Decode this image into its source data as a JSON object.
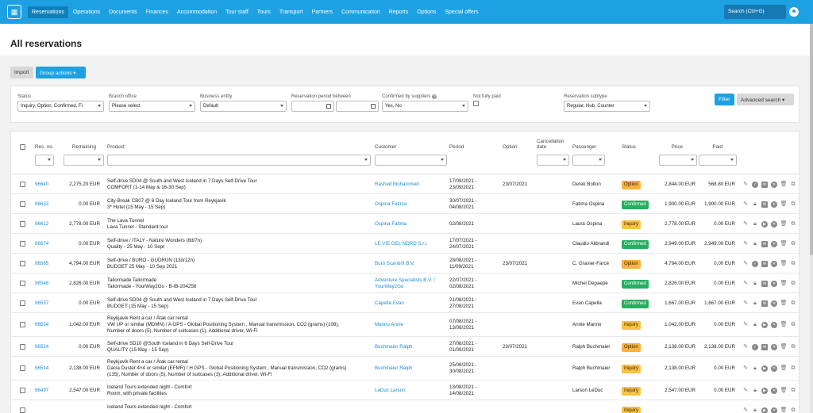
{
  "nav": {
    "items": [
      "Reservations",
      "Operations",
      "Documents",
      "Finances",
      "Accommodation",
      "Tour staff",
      "Tours",
      "Transport",
      "Partners",
      "Communication",
      "Reports",
      "Options",
      "Special offers"
    ],
    "search_label": "Search (Ctrl+G)"
  },
  "page": {
    "title": "All reservations"
  },
  "actions": {
    "import_label": "Import",
    "group_actions_label": "Group actions ▾"
  },
  "filters": {
    "status_label": "Status",
    "status_value": "Inquiry, Option, Confirmed, Fi",
    "branch_label": "Branch office",
    "branch_value": "Please select",
    "entity_label": "Business entity",
    "entity_value": "Default",
    "period_label": "Reservation period between",
    "confirmed_label": "Confirmed by suppliers",
    "confirmed_value": "Yes, No",
    "not_paid_label": "Not fully paid",
    "subtype_label": "Reservation subtype",
    "subtype_value": "Regular, Hub, Counter",
    "filter_label": "Filter",
    "advanced_label": "Advanced search ▾"
  },
  "table": {
    "headers": {
      "res_no": "Res. no.",
      "remaining": "Remaining",
      "product": "Product",
      "customer": "Customer",
      "period": "Period",
      "option": "Option",
      "cancellation_1": "Cancellation",
      "cancellation_2": "date",
      "passenger": "Passenger",
      "status": "Status",
      "price": "Price",
      "paid": "Paid"
    },
    "rows": [
      {
        "no": "96640",
        "remaining": "2,275.20 EUR",
        "product1": "Self-drive SD04 @ South and West Iceland in 7 Days Self-Drive Tour",
        "product2": "COMFORT (1-14 May & 16-30 Sep)",
        "product3": "",
        "customer1": "Rashed Mohammed",
        "customer2": "",
        "period1": "17/09/2021 -",
        "period2": "23/09/2021",
        "option": "23/07/2021",
        "passenger": "Derek Bolton",
        "status": "Option",
        "price": "2,844.00 EUR",
        "paid": "568.80 EUR"
      },
      {
        "no": "96633",
        "remaining": "0.00 EUR",
        "product1": "City-Break CB07 @ 6 Day Iceland Tour from Reykjavik",
        "product2": "3* Hotel (15 May - 15 Sep)",
        "product3": "",
        "customer1": "Ospina Fatima",
        "customer2": "",
        "period1": "30/07/2021 -",
        "period2": "04/08/2021",
        "option": "",
        "passenger": "Fatima Ospina",
        "status": "Confirmed",
        "price": "1,900.00 EUR",
        "paid": "1,900.00 EUR"
      },
      {
        "no": "96612",
        "remaining": "2,778.00 EUR",
        "product1": "The Lava Tunnel",
        "product2": "Lava Tunnel - Standard tour",
        "product3": "",
        "customer1": "Ospina Fatima",
        "customer2": "",
        "period1": "02/08/2021",
        "period2": "",
        "option": "",
        "passenger": "Laura Ospina",
        "status": "Inquiry",
        "price": "2,778.00 EUR",
        "paid": "0.00 EUR"
      },
      {
        "no": "96574",
        "remaining": "0.00 EUR",
        "product1": "Self-drive / ITALY - Nature Wonders (8d/7n)",
        "product2": "Quality - 25 May - 10 Sept",
        "product3": "",
        "customer1": "LE VIE DEL NORD S.r.l.",
        "customer2": "",
        "period1": "17/07/2021 -",
        "period2": "24/07/2021",
        "option": "",
        "passenger": "Claudio Alibrandi",
        "status": "Confirmed",
        "price": "2,949.00 EUR",
        "paid": "2,949.00 EUR"
      },
      {
        "no": "96565",
        "remaining": "4,794.00 EUR",
        "product1": "Self-drive / BURO - GUDRUN (13d/12n)",
        "product2": "BUDGET 25 May - 10 Sep 2021",
        "product3": "",
        "customer1": "Buro Scanbrit B.V.",
        "customer2": "",
        "period1": "28/08/2021 -",
        "period2": "11/09/2021",
        "option": "23/07/2021",
        "passenger": "C. Gravier-Farcé",
        "status": "Option",
        "price": "4,794.00 EUR",
        "paid": "0.00 EUR"
      },
      {
        "no": "96548",
        "remaining": "2,826.00 EUR",
        "product1": "Tailormade Tailormade",
        "product2": "Tailormade - YourWay2Go - B-IB-204258",
        "product3": "",
        "customer1": "Adventure Specialists B.V. /",
        "customer2": "YourWay2Go",
        "period1": "22/07/2021 -",
        "period2": "02/08/2021",
        "option": "",
        "passenger": "Michel Depaepe",
        "status": "Confirmed",
        "price": "2,826.00 EUR",
        "paid": "0.00 EUR"
      },
      {
        "no": "96537",
        "remaining": "0.00 EUR",
        "product1": "Self-drive SD04 @ South and West Iceland in 7 Days Self-Drive Tour",
        "product2": "BUDGET (15 May - 15 Sep)",
        "product3": "",
        "customer1": "Capella Evan",
        "customer2": "",
        "period1": "21/08/2021 -",
        "period2": "27/08/2021",
        "option": "",
        "passenger": "Evan Capella",
        "status": "Confirmed",
        "price": "1,667.00 EUR",
        "paid": "1,667.00 EUR"
      },
      {
        "no": "96534",
        "remaining": "1,042.00 EUR",
        "product1": "Reykjavik Rent a car / Átak car rental",
        "product2": "VW UP or similar (MDMN) / A GPS - Global Positioning System , Manual transmission, CO2 (grams) (108),",
        "product3": "Number of doors (5), Number of suitcases (1), Additional driver, Wi-Fi",
        "customer1": "Manno Annie",
        "customer2": "",
        "period1": "07/08/2021 -",
        "period2": "13/08/2021",
        "option": "",
        "passenger": "Annie Manno",
        "status": "Inquiry",
        "price": "1,042.00 EUR",
        "paid": "0.00 EUR"
      },
      {
        "no": "96524",
        "remaining": "0.00 EUR",
        "product1": "Self-drive SD10 @South Iceland in 6 Days Self-Drive Tour",
        "product2": "QUALITY (15 May - 15 Sep)",
        "product3": "",
        "customer1": "Buchmaier Ralph",
        "customer2": "",
        "period1": "27/08/2021 -",
        "period2": "01/09/2021",
        "option": "23/07/2021",
        "passenger": "Ralph Buchmaier",
        "status": "Option",
        "price": "2,138.00 EUR",
        "paid": "2,138.00 EUR"
      },
      {
        "no": "96514",
        "remaining": "2,138.00 EUR",
        "product1": "Reykjavik Rent a car / Átak car rental",
        "product2": "Dacia Duster 4×4 or similar (EFMR) / H GPS - Global Positioning System , Manual transmission, CO2 (grams)",
        "product3": "(135), Number of doors (5), Number of suitcases (3), Additional driver, Wi-Fi",
        "customer1": "Buchmaier Ralph",
        "customer2": "",
        "period1": "25/08/2021 -",
        "period2": "30/08/2021",
        "option": "",
        "passenger": "Ralph Buchmaier",
        "status": "Inquiry",
        "price": "2,138.00 EUR",
        "paid": "0.00 EUR"
      },
      {
        "no": "96497",
        "remaining": "2,547.00 EUR",
        "product1": "Iceland Tours extended night - Comfort",
        "product2": "Room, with private facilities",
        "product3": "",
        "customer1": "LeDuc Larson",
        "customer2": "",
        "period1": "13/08/2021 -",
        "period2": "14/08/2021",
        "option": "",
        "passenger": "Larson LeDuc",
        "status": "Inquiry",
        "price": "2,547.00 EUR",
        "paid": "0.00 EUR"
      },
      {
        "no": "",
        "remaining": "",
        "product1": "Iceland Tours extended night - Comfort",
        "product2": "",
        "product3": "",
        "customer1": "",
        "customer2": "",
        "period1": "",
        "period2": "",
        "option": "",
        "passenger": "",
        "status": "Inquiry",
        "price": "",
        "paid": ""
      }
    ]
  },
  "colors": {
    "accent": "#1da1e2",
    "option": "#f7b33d",
    "confirmed": "#27ae60",
    "inquiry": "#f7c342"
  },
  "icons": [
    "grid-logo-icon",
    "user-icon",
    "calendar-icon",
    "help-icon",
    "chevron-down-icon",
    "edit-icon",
    "check-icon",
    "lock-icon",
    "play-icon",
    "message-icon",
    "cancel-icon",
    "trash-icon",
    "copy-icon"
  ]
}
